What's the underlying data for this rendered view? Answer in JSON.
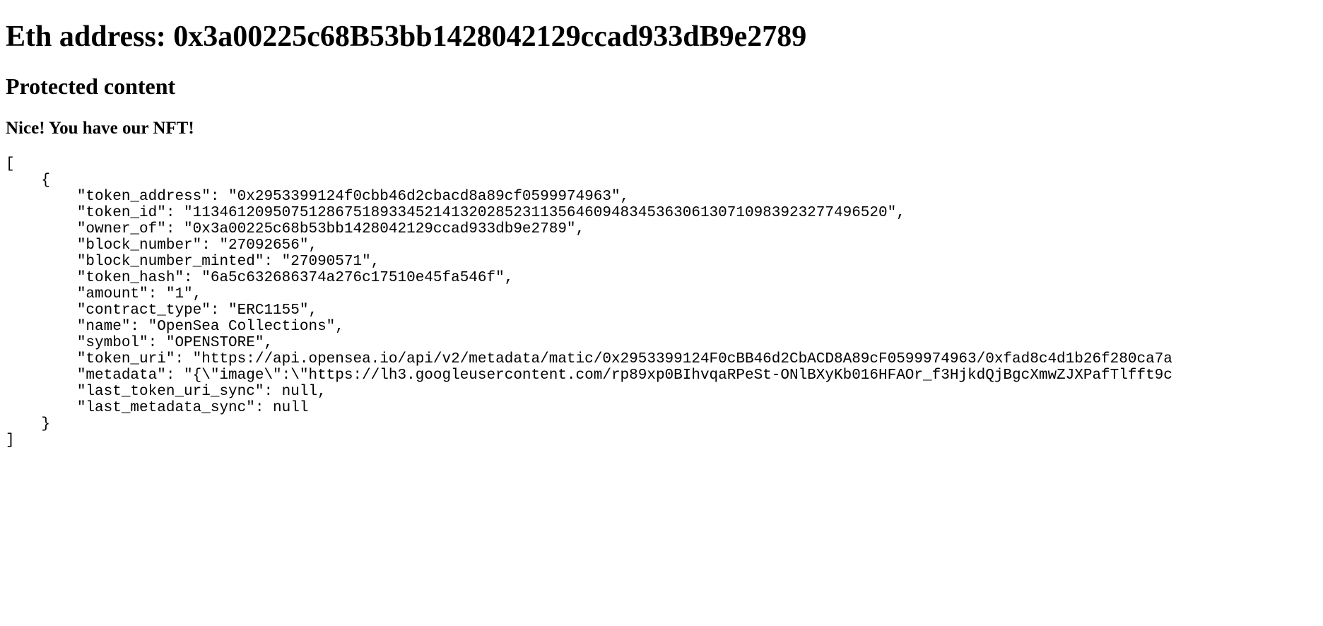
{
  "heading": "Eth address: 0x3a00225c68B53bb1428042129ccad933dB9e2789",
  "subheading": "Protected content",
  "subsubheading": "Nice! You have our NFT!",
  "code": "[\n    {\n        \"token_address\": \"0x2953399124f0cbb46d2cbacd8a89cf0599974963\",\n        \"token_id\": \"113461209507512867518933452141320285231135646094834536306130710983923277496520\",\n        \"owner_of\": \"0x3a00225c68b53bb1428042129ccad933db9e2789\",\n        \"block_number\": \"27092656\",\n        \"block_number_minted\": \"27090571\",\n        \"token_hash\": \"6a5c632686374a276c17510e45fa546f\",\n        \"amount\": \"1\",\n        \"contract_type\": \"ERC1155\",\n        \"name\": \"OpenSea Collections\",\n        \"symbol\": \"OPENSTORE\",\n        \"token_uri\": \"https://api.opensea.io/api/v2/metadata/matic/0x2953399124F0cBB46d2CbACD8A89cF0599974963/0xfad8c4d1b26f280ca7a\n        \"metadata\": \"{\\\"image\\\":\\\"https://lh3.googleusercontent.com/rp89xp0BIhvqaRPeSt-ONlBXyKb016HFAOr_f3HjkdQjBgcXmwZJXPafTlfft9c\n        \"last_token_uri_sync\": null,\n        \"last_metadata_sync\": null\n    }\n]"
}
